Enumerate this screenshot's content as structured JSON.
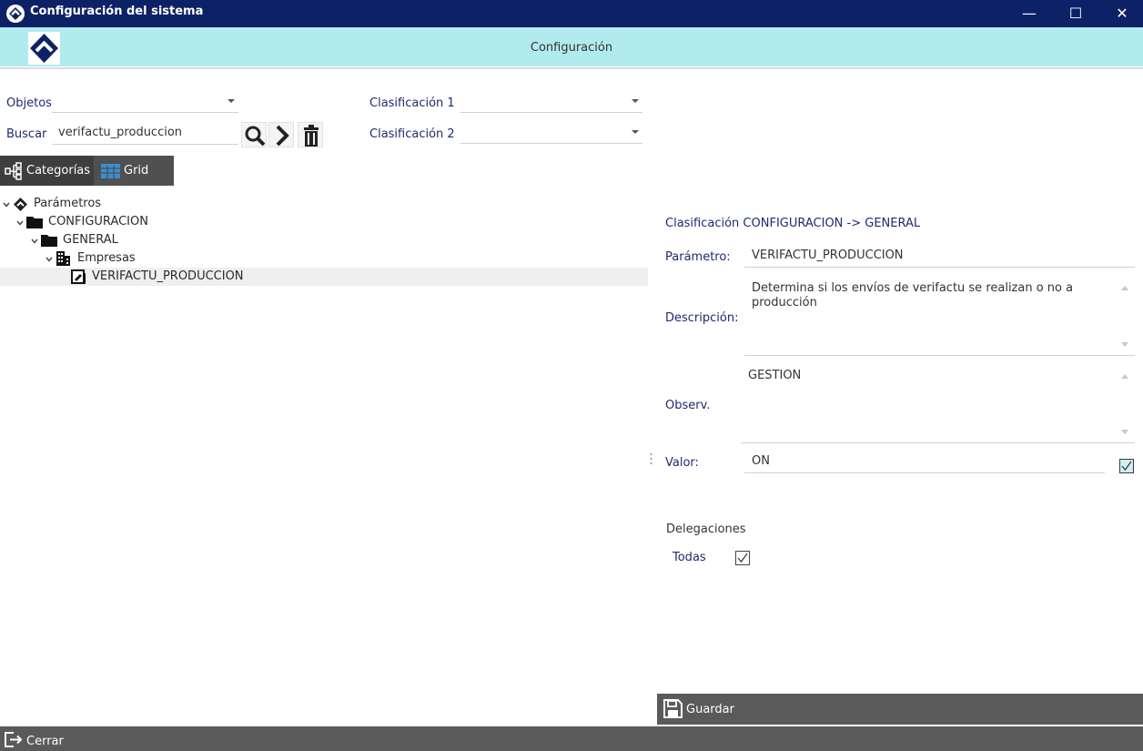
{
  "window": {
    "title": "Configuración del sistema",
    "controls": {
      "minimize": "—",
      "maximize": "☐",
      "close": "✕"
    }
  },
  "header": {
    "title": "Configuración"
  },
  "filters": {
    "objetos_label": "Objetos",
    "buscar_label": "Buscar",
    "search_value": "verifactu_produccion",
    "clasificacion1_label": "Clasificación 1",
    "clasificacion1_value": "",
    "clasificacion2_label": "Clasificación 2",
    "clasificacion2_value": ""
  },
  "tabs": [
    {
      "label": "Categorías",
      "icon": "hierarchy-icon"
    },
    {
      "label": "Grid",
      "icon": "grid-table-icon"
    }
  ],
  "tree": [
    {
      "label": "Parámetros",
      "icon": "app-logo-icon",
      "level": 0
    },
    {
      "label": "CONFIGURACION",
      "icon": "folder-icon",
      "level": 1
    },
    {
      "label": "GENERAL",
      "icon": "folder-icon",
      "level": 2
    },
    {
      "label": "Empresas",
      "icon": "building-icon",
      "level": 3
    },
    {
      "label": "VERIFACTU_PRODUCCION",
      "icon": "parameter-doc-icon",
      "level": 4,
      "selected": true
    }
  ],
  "detail": {
    "clasificacion": "Clasificación CONFIGURACION -> GENERAL",
    "parametro_label": "Parámetro:",
    "parametro_value": "VERIFACTU_PRODUCCION",
    "descripcion_label": "Descripción:",
    "descripcion_line1": "Determina si los envíos de verifactu se realizan o no a",
    "descripcion_line2": "producción",
    "observ_label": "Observ.",
    "observ_value": "GESTION",
    "valor_label": "Valor:",
    "valor_value": "ON",
    "valor_checked": true,
    "delegaciones_label": "Delegaciones",
    "todas_label": "Todas",
    "todas_checked": true
  },
  "buttons": {
    "guardar": "Guardar",
    "cerrar": "Cerrar"
  },
  "colors": {
    "titlebar": "#0d2266",
    "header": "#b2ebee",
    "toolbar_dark": "#505050",
    "label_blue": "#1e2a72"
  }
}
